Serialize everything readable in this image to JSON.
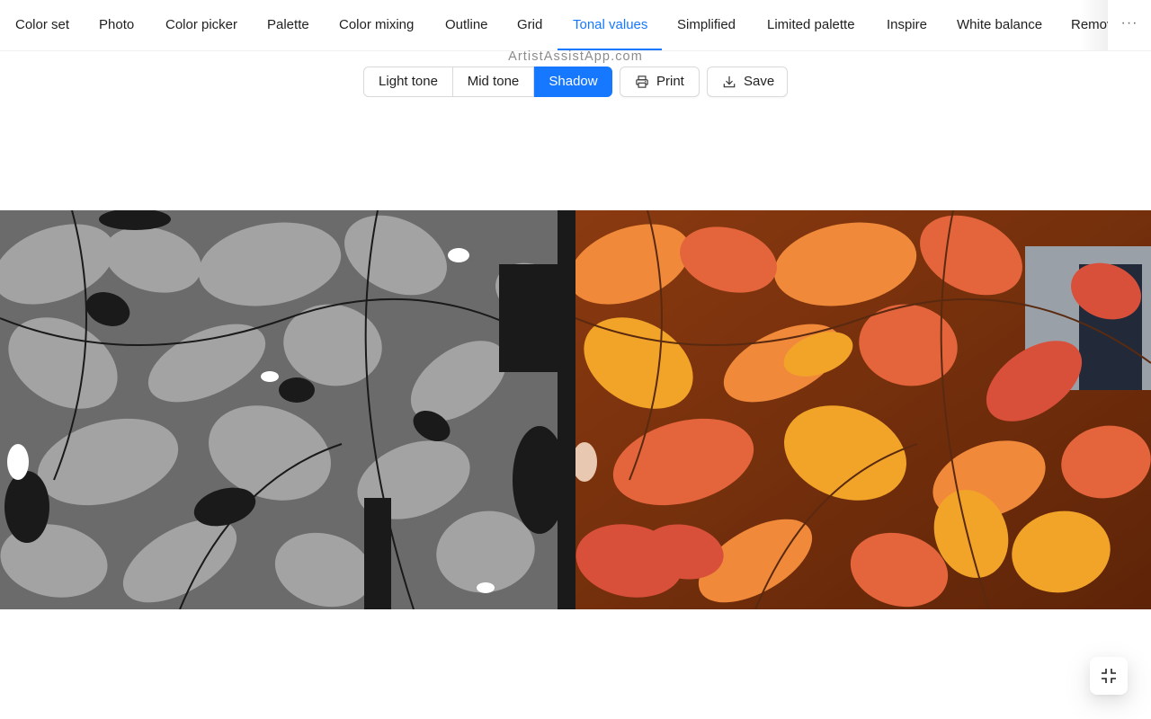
{
  "tabs": [
    {
      "label": "Color set",
      "active": false
    },
    {
      "label": "Photo",
      "active": false
    },
    {
      "label": "Color picker",
      "active": false
    },
    {
      "label": "Palette",
      "active": false
    },
    {
      "label": "Color mixing",
      "active": false
    },
    {
      "label": "Outline",
      "active": false
    },
    {
      "label": "Grid",
      "active": false
    },
    {
      "label": "Tonal values",
      "active": true
    },
    {
      "label": "Simplified",
      "active": false
    },
    {
      "label": "Limited palette",
      "active": false
    },
    {
      "label": "Inspire",
      "active": false
    },
    {
      "label": "White balance",
      "active": false
    },
    {
      "label": "Remov",
      "active": false
    }
  ],
  "more_label": "···",
  "watermark": "ArtistAssistApp.com",
  "toolbar": {
    "segments": [
      {
        "label": "Light tone",
        "active": false
      },
      {
        "label": "Mid tone",
        "active": false
      },
      {
        "label": "Shadow",
        "active": true
      }
    ],
    "print_label": "Print",
    "print_icon": "printer-icon",
    "save_label": "Save",
    "save_icon": "download-icon"
  },
  "images": {
    "left": "tonal-values-shadow-map",
    "right": "original-autumn-leaves-photo"
  },
  "fullscreen_icon": "exit-fullscreen-icon",
  "colors": {
    "accent": "#1677ff",
    "border": "#d9d9d9",
    "text": "rgba(0,0,0,0.88)",
    "watermark": "#8c8c8c"
  }
}
